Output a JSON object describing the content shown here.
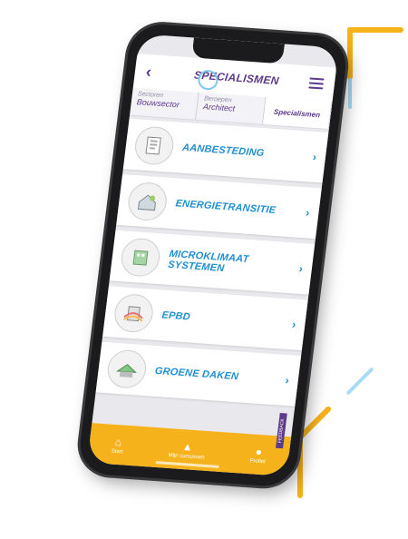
{
  "header": {
    "back_icon": "chevron-left-icon",
    "title": "SPECIALISMEN",
    "menu_icon": "hamburger-menu-icon"
  },
  "breadcrumbs": [
    {
      "caption": "Sectoren",
      "value": "Bouwsector"
    },
    {
      "caption": "Beroepen",
      "value": "Architect"
    },
    {
      "caption": "",
      "value": "Specialismen"
    }
  ],
  "items": [
    {
      "label": "AANBESTEDING",
      "icon": "document-stack-icon"
    },
    {
      "label": "ENERGIETRANSITIE",
      "icon": "energy-house-icon"
    },
    {
      "label": "MICROKLIMAAT SYSTEMEN",
      "icon": "building-block-icon"
    },
    {
      "label": "EPBD",
      "icon": "epbd-building-icon"
    },
    {
      "label": "GROENE DAKEN",
      "icon": "green-roof-icon"
    }
  ],
  "tabs": [
    {
      "label": "Start",
      "icon": "home-icon"
    },
    {
      "label": "Mijn cursussen",
      "icon": "graduation-cap-icon"
    },
    {
      "label": "Profiel",
      "icon": "user-icon"
    }
  ],
  "feedback_label": "FEEDBACK",
  "colors": {
    "accent": "#f5b21a",
    "brand": "#5b3a8a",
    "link": "#1f8fd0",
    "highlight": "#a9dcf4"
  }
}
